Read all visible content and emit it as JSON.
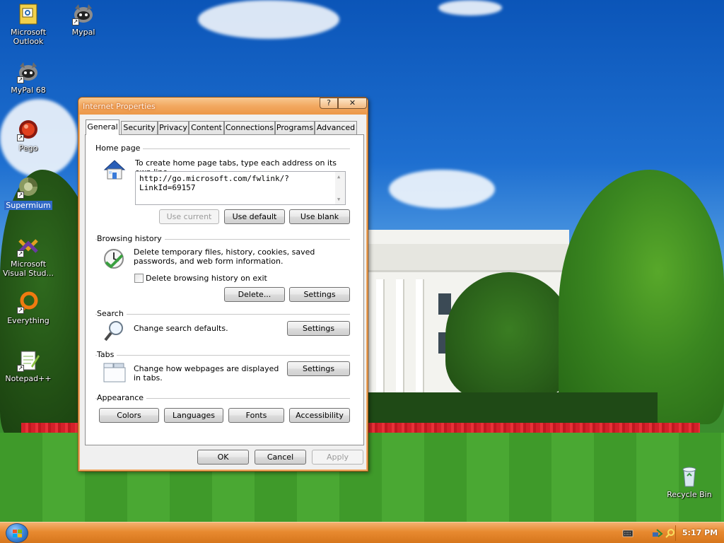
{
  "desktop": {
    "icons": [
      {
        "label": "Microsoft\nOutlook"
      },
      {
        "label": "Mypal"
      },
      {
        "label": "MyPal 68"
      },
      {
        "label": "Pego"
      },
      {
        "label": "Supermium"
      },
      {
        "label": "Microsoft\nVisual Stud..."
      },
      {
        "label": "Everything"
      },
      {
        "label": "Notepad++"
      },
      {
        "label": "Recycle Bin"
      }
    ]
  },
  "dialog": {
    "title": "Internet Properties",
    "help_glyph": "?",
    "close_glyph": "✕",
    "tabs": [
      "General",
      "Security",
      "Privacy",
      "Content",
      "Connections",
      "Programs",
      "Advanced"
    ],
    "active_tab": "General",
    "home_page": {
      "title": "Home page",
      "description": "To create home page tabs, type each address on its own line.",
      "url": "http://go.microsoft.com/fwlink/?LinkId=69157",
      "use_current": "Use current",
      "use_default": "Use default",
      "use_blank": "Use blank"
    },
    "browsing_history": {
      "title": "Browsing history",
      "description": "Delete temporary files, history, cookies, saved passwords, and web form information.",
      "checkbox_label": "Delete browsing history on exit",
      "checkbox_checked": false,
      "delete": "Delete...",
      "settings": "Settings"
    },
    "search": {
      "title": "Search",
      "description": "Change search defaults.",
      "settings": "Settings"
    },
    "tabs_section": {
      "title": "Tabs",
      "description": "Change how webpages are displayed in tabs.",
      "settings": "Settings"
    },
    "appearance": {
      "title": "Appearance",
      "colors": "Colors",
      "languages": "Languages",
      "fonts": "Fonts",
      "accessibility": "Accessibility"
    },
    "footer": {
      "ok": "OK",
      "cancel": "Cancel",
      "apply": "Apply"
    }
  },
  "taskbar": {
    "clock": "5:17 PM",
    "tray_icons": [
      "keyboard-icon",
      "network-icon",
      "search-icon"
    ]
  }
}
